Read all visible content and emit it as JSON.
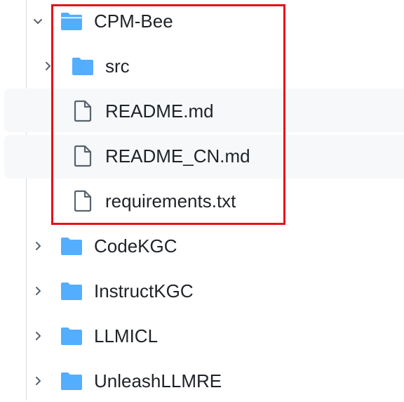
{
  "colors": {
    "folder": "#54aeff",
    "file_outline": "#59636e",
    "chevron": "#59636e",
    "highlight_border": "#e3101a",
    "hover_background": "#f6f8fa"
  },
  "tree": {
    "cpm_bee": {
      "label": "CPM-Bee",
      "icon": "folder-open-icon",
      "expanded": true
    },
    "src": {
      "label": "src",
      "icon": "folder-icon"
    },
    "readme": {
      "label": "README.md",
      "icon": "file-icon"
    },
    "readme_cn": {
      "label": "README_CN.md",
      "icon": "file-icon"
    },
    "requirements": {
      "label": "requirements.txt",
      "icon": "file-icon"
    },
    "codekgc": {
      "label": "CodeKGC",
      "icon": "folder-icon"
    },
    "instructkgc": {
      "label": "InstructKGC",
      "icon": "folder-icon"
    },
    "llmicl": {
      "label": "LLMICL",
      "icon": "folder-icon"
    },
    "unleashllmre": {
      "label": "UnleashLLMRE",
      "icon": "folder-icon"
    }
  }
}
